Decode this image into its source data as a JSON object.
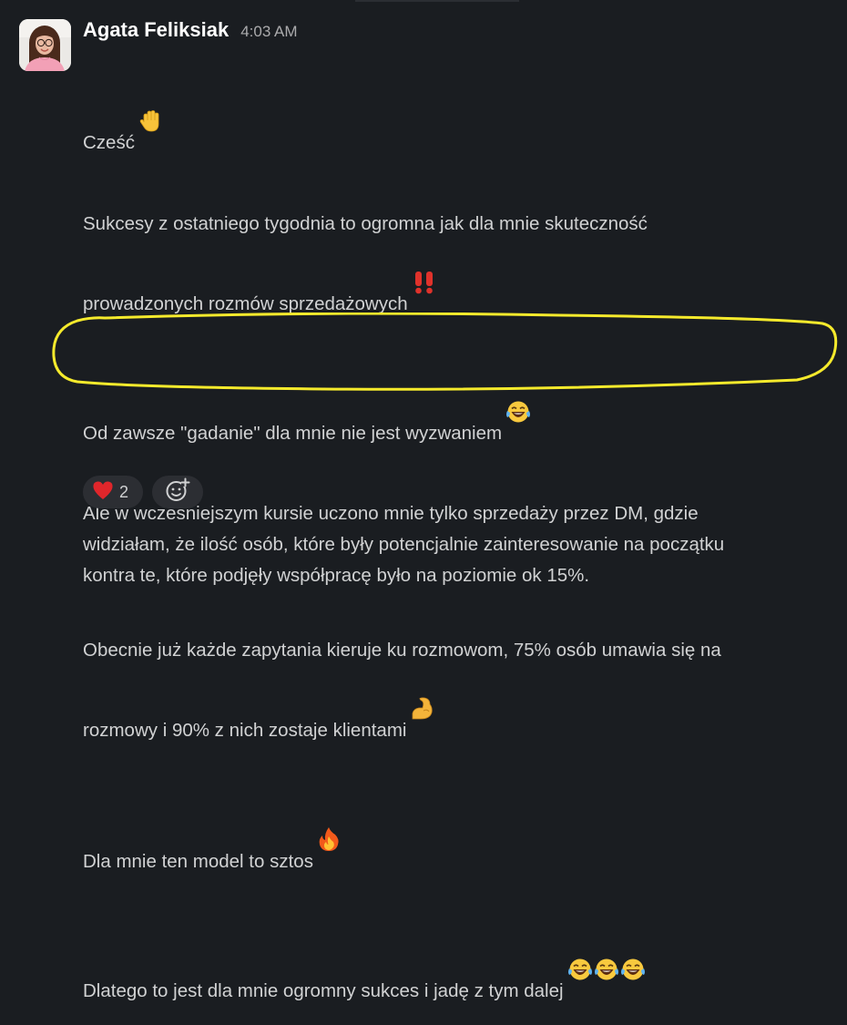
{
  "message": {
    "author": "Agata Feliksiak",
    "timestamp": "4:03 AM",
    "paragraphs": [
      {
        "text": "Cześć",
        "emojis": [
          "raised-hand-icon"
        ]
      },
      {
        "text": "Sukcesy z ostatniego tygodnia to ogromna jak dla mnie skuteczność\nprowadzonych rozmów sprzedażowych",
        "emojis": [
          "double-exclamation-icon"
        ]
      },
      {
        "text": "Od zawsze \"gadanie\" dla mnie nie jest wyzwaniem",
        "emojis": [
          "tears-of-joy-icon"
        ]
      },
      {
        "text": "Ale w wcześniejszym kursie uczono mnie tylko sprzedaży przez DM, gdzie\nwidziałam, że ilość osób, które były potencjalnie zainteresowanie na początku\nkontra te, które podjęły współpracę było na poziomie ok 15%.",
        "emojis": []
      },
      {
        "text": "Obecnie już każde zapytania kieruje ku rozmowom, 75% osób umawia się na\nrozmowy i 90% z nich zostaje klientami",
        "emojis": [
          "flexed-biceps-icon"
        ]
      },
      {
        "text": "Dla mnie ten model to sztos",
        "emojis": [
          "fire-icon"
        ]
      },
      {
        "text": "Dlatego to jest dla mnie ogromny sukces i jadę z tym dalej",
        "emojis": [
          "tears-of-joy-icon",
          "tears-of-joy-icon",
          "tears-of-joy-icon"
        ]
      }
    ],
    "highlighted_paragraph": 4,
    "highlight_color": "#f5ea2c"
  },
  "reactions": [
    {
      "emoji": "heart-icon",
      "count": "2"
    }
  ],
  "add_reaction_icon": "add-reaction-icon",
  "colors": {
    "background": "#1a1d21",
    "text": "#d1d2d3",
    "author": "#ffffff",
    "timestamp": "#ababad",
    "reaction_bg": "#2c2e33"
  }
}
